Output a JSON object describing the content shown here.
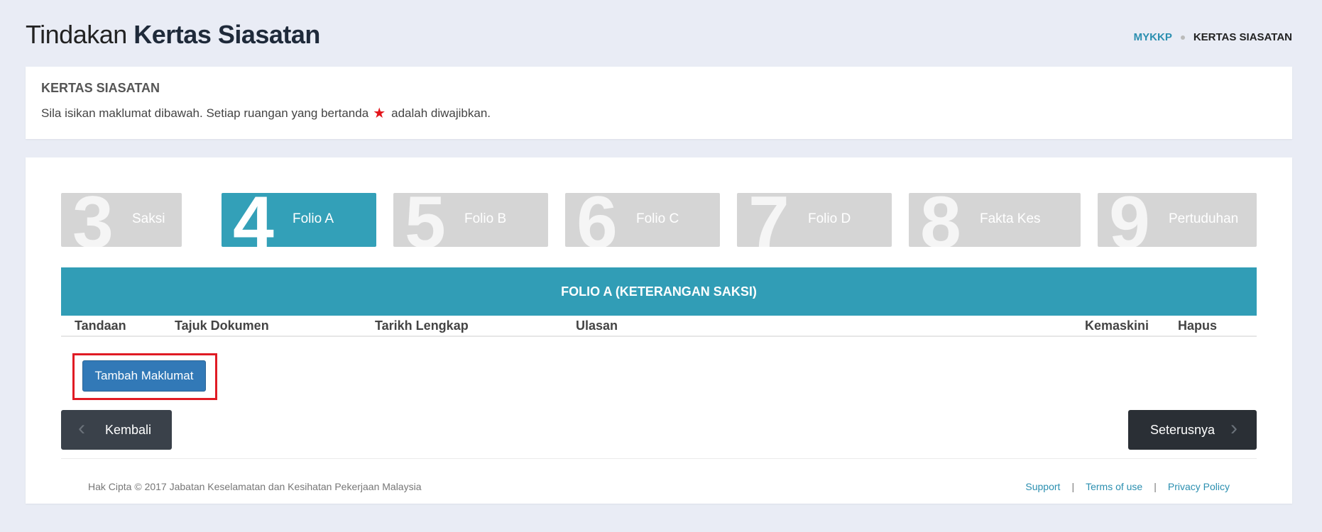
{
  "header": {
    "title_light": "Tindakan",
    "title_bold": "Kertas Siasatan",
    "breadcrumb": {
      "home": "MYKKP",
      "current": "KERTAS SIASATAN"
    }
  },
  "info": {
    "title": "KERTAS SIASATAN",
    "text_before": "Sila isikan maklumat dibawah. Setiap ruangan yang bertanda",
    "text_after": "adalah diwajibkan.",
    "required_icon": "star-icon",
    "required_color": "#e3141b"
  },
  "steps": [
    {
      "number": "3",
      "label": "Saksi",
      "active": false
    },
    {
      "number": "4",
      "label": "Folio A",
      "active": true
    },
    {
      "number": "5",
      "label": "Folio B",
      "active": false
    },
    {
      "number": "6",
      "label": "Folio C",
      "active": false
    },
    {
      "number": "7",
      "label": "Folio D",
      "active": false
    },
    {
      "number": "8",
      "label": "Fakta Kes",
      "active": false
    },
    {
      "number": "9",
      "label": "Pertuduhan",
      "active": false
    }
  ],
  "table": {
    "caption": "FOLIO A (KETERANGAN SAKSI)",
    "columns": [
      "Tandaan",
      "Tajuk Dokumen",
      "Tarikh Lengkap",
      "Ulasan",
      "Kemaskini",
      "Hapus"
    ]
  },
  "actions": {
    "add": "Tambah Maklumat",
    "back": "Kembali",
    "next": "Seterusnya"
  },
  "footer": {
    "copyright": "Hak Cipta © 2017 Jabatan Keselamatan dan Kesihatan Pekerjaan Malaysia",
    "links": [
      "Support",
      "Terms of use",
      "Privacy Policy"
    ]
  },
  "colors": {
    "accent": "#33a0b8",
    "step_inactive": "#d5d5d5",
    "primary_button": "#3279b7",
    "dark_button": "#2a2f35",
    "highlight": "#e01b24"
  }
}
